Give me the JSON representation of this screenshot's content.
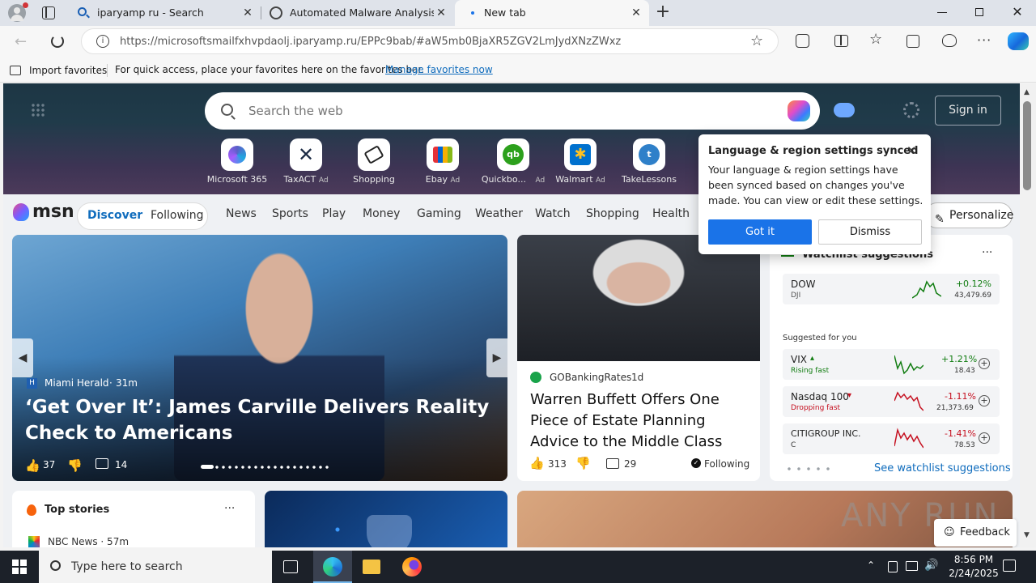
{
  "tabs": [
    {
      "title": "iparyamp ru - Search",
      "active": false
    },
    {
      "title": "Automated Malware Analysis Ma",
      "active": false
    },
    {
      "title": "New tab",
      "active": true
    }
  ],
  "address_bar": {
    "url": "https://microsoftsmailfxhvpdaolj.iparyamp.ru/EPPc9bab/#aW5mb0BjaXR5ZGV2LmJydXNzZWxz"
  },
  "favorites_bar": {
    "import_label": "Import favorites",
    "hint": "For quick access, place your favorites here on the favorites bar.",
    "manage_link": "Manage favorites now"
  },
  "search": {
    "placeholder": "Search the web"
  },
  "header": {
    "sign_in": "Sign in"
  },
  "quick_links": [
    {
      "label": "Microsoft 365",
      "ad": ""
    },
    {
      "label": "TaxACT",
      "ad": "Ad"
    },
    {
      "label": "Shopping",
      "ad": ""
    },
    {
      "label": "Ebay",
      "ad": "Ad"
    },
    {
      "label": "Quickbo...",
      "ad": "Ad"
    },
    {
      "label": "Walmart",
      "ad": "Ad"
    },
    {
      "label": "TakeLessons",
      "ad": ""
    }
  ],
  "sync_popup": {
    "title": "Language & region settings synced",
    "body": "Your language & region settings have been synced based on changes you've made. You can view or edit these settings.",
    "got_it": "Got it",
    "dismiss": "Dismiss"
  },
  "msn": {
    "logo": "msn",
    "discover": "Discover",
    "following": "Following",
    "nav": [
      "News",
      "Sports",
      "Play",
      "Money",
      "Gaming",
      "Weather",
      "Watch",
      "Shopping",
      "Health"
    ],
    "personalize": "Personalize"
  },
  "hero_story": {
    "source": "Miami Herald",
    "age": "31m",
    "title": "‘Get Over It’: James Carville Delivers Reality Check to Americans",
    "likes": "37",
    "comments": "14"
  },
  "side_story": {
    "source": "GOBankingRates",
    "age": "1d",
    "title": "Warren Buffett Offers One Piece of Estate Planning Advice to the Middle Class",
    "likes": "313",
    "comments": "29",
    "following": "Following"
  },
  "watchlist": {
    "title": "Watchlist suggestions",
    "main": {
      "name": "DOW",
      "sub": "DJI",
      "change": "+0.12%",
      "value": "43,479.69"
    },
    "suggested_label": "Suggested for you",
    "items": [
      {
        "name": "VIX",
        "status": "Rising fast",
        "change": "+1.21%",
        "value": "18.43"
      },
      {
        "name": "Nasdaq 100",
        "status": "Dropping fast",
        "change": "-1.11%",
        "value": "21,373.69"
      },
      {
        "name": "CITIGROUP INC.",
        "status": "C",
        "change": "-1.41%",
        "value": "78.53"
      }
    ],
    "see_more": "See watchlist suggestions"
  },
  "top_stories": {
    "title": "Top stories",
    "first_source": "NBC News · 57m"
  },
  "feedback": "Feedback",
  "watermark": "ANY RUN",
  "taskbar": {
    "search_placeholder": "Type here to search",
    "time": "8:56 PM",
    "date": "2/24/2025"
  },
  "colors": {
    "accent": "#0f6cbd",
    "positive": "#107c10",
    "negative": "#c50f1f",
    "gotit": "#1a73e8"
  }
}
